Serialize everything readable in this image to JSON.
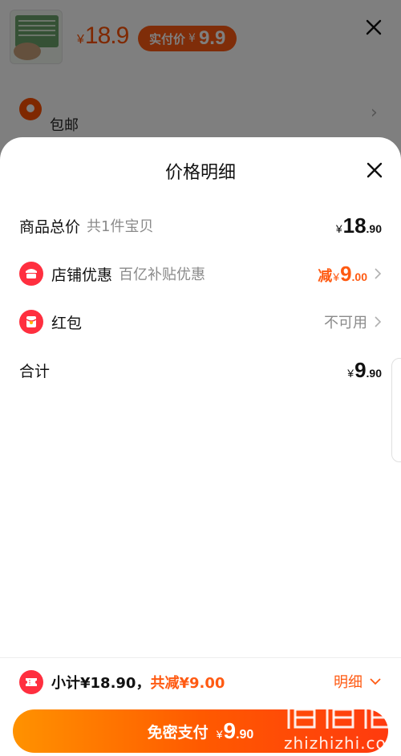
{
  "background": {
    "product": {
      "price_yen": "¥",
      "price": "18.9"
    },
    "pay_tag": {
      "label": "实付价",
      "yen": "¥",
      "value": "9.9"
    },
    "shipping": {
      "label": "包邮"
    }
  },
  "modal": {
    "title": "价格明细",
    "rows": [
      {
        "label": "商品总价",
        "sub": "共1件宝贝",
        "yen": "¥",
        "int": "18",
        "dec": ".90"
      },
      {
        "label": "店铺优惠",
        "sub": "百亿补贴优惠",
        "prefix": "减",
        "yen": "¥",
        "int": "9",
        "dec": ".00"
      },
      {
        "label": "红包",
        "status": "不可用"
      },
      {
        "label": "合计",
        "yen": "¥",
        "int": "9",
        "dec": ".90"
      }
    ]
  },
  "footer": {
    "subtotal": "小计¥18.90，",
    "saving": "共减¥9.00",
    "detail_label": "明细",
    "pay_label": "免密支付",
    "pay_yen": "¥",
    "pay_int": "9",
    "pay_dec": ".90"
  },
  "watermark": {
    "text": "zhizhizhi.com",
    "logo": "值值值"
  },
  "colors": {
    "accent": "#ff5a12",
    "badge": "#ff2f3f"
  }
}
